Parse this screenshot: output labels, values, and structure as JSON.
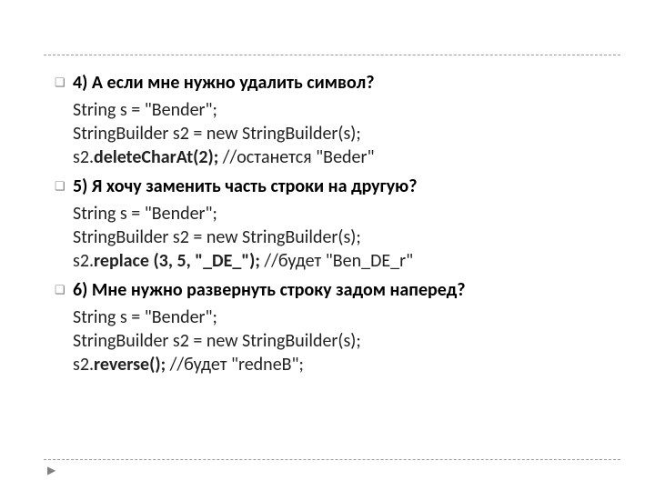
{
  "items": [
    {
      "heading": "4) А если мне нужно удалить символ?",
      "code": [
        {
          "pre": "String s = \"Bender\";"
        },
        {
          "pre": "StringBuilder s2 = new StringBuilder(s);"
        },
        {
          "pre": "s2.",
          "bold": "deleteCharAt(2);",
          "post": " //останется \"Beder\""
        }
      ]
    },
    {
      "heading": "5) Я хочу заменить часть строки на другую?",
      "code": [
        {
          "pre": "String s = \"Bender\";"
        },
        {
          "pre": "StringBuilder s2 = new StringBuilder(s);"
        },
        {
          "pre": "s2.",
          "bold": "replace (3, 5, \"_DE_\");",
          "post": " //будет \"Ben_DE_r\""
        }
      ]
    },
    {
      "heading": "6) Мне нужно развернуть строку задом наперед?",
      "code": [
        {
          "pre": "String s = \"Bender\";"
        },
        {
          "pre": "StringBuilder s2 = new StringBuilder(s);"
        },
        {
          "pre": "s2.",
          "bold": "reverse();",
          "post": " //будет \"redneB\";"
        }
      ]
    }
  ]
}
